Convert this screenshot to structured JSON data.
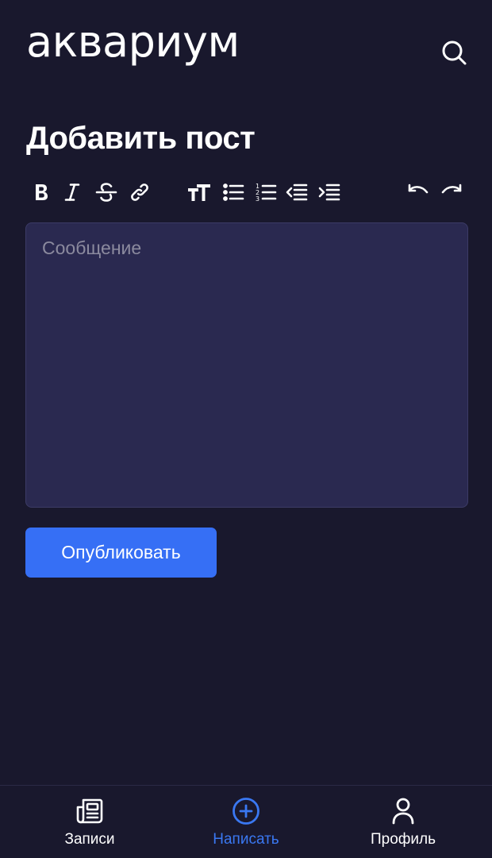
{
  "header": {
    "logo_text": "аквариум",
    "search_icon": "search-icon"
  },
  "page": {
    "title": "Добавить пост"
  },
  "toolbar": {
    "items": [
      "bold-icon",
      "italic-icon",
      "strikethrough-icon",
      "link-icon",
      "text-size-icon",
      "bullet-list-icon",
      "numbered-list-icon",
      "outdent-icon",
      "indent-icon",
      "undo-icon",
      "redo-icon"
    ]
  },
  "editor": {
    "placeholder": "Сообщение",
    "value": ""
  },
  "actions": {
    "publish_label": "Опубликовать"
  },
  "nav": {
    "posts_label": "Записи",
    "write_label": "Написать",
    "profile_label": "Профиль",
    "active": "write"
  },
  "colors": {
    "background": "#19182d",
    "editor_bg": "#2a2950",
    "accent": "#366ff5",
    "active_nav": "#3a78f2"
  }
}
